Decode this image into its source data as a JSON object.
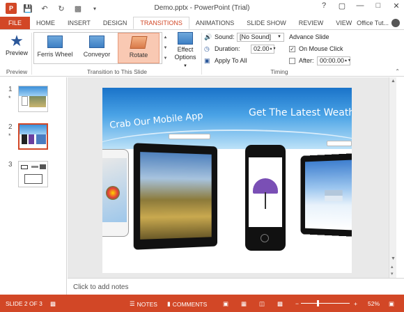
{
  "window": {
    "title": "Demo.pptx - PowerPoint (Trial)",
    "controls": [
      "?",
      "▢",
      "—",
      "□",
      "✕"
    ]
  },
  "ribbon_tabs": [
    "FILE",
    "HOME",
    "INSERT",
    "DESIGN",
    "TRANSITIONS",
    "ANIMATIONS",
    "SLIDE SHOW",
    "REVIEW",
    "VIEW"
  ],
  "active_tab": "TRANSITIONS",
  "account": {
    "name": "Office Tut..."
  },
  "preview": {
    "label": "Preview",
    "group_label": "Preview"
  },
  "transitions": {
    "items": [
      "Ferris Wheel",
      "Conveyor",
      "Rotate"
    ],
    "selected": "Rotate",
    "group_label": "Transition to This Slide",
    "effect_options_line1": "Effect",
    "effect_options_line2": "Options"
  },
  "timing": {
    "sound_label": "Sound:",
    "sound_value": "[No Sound]",
    "duration_label": "Duration:",
    "duration_value": "02.00",
    "apply_all_label": "Apply To All",
    "advance_label": "Advance Slide",
    "on_click_label": "On Mouse Click",
    "on_click_checked": true,
    "after_label": "After:",
    "after_checked": false,
    "after_value": "00:00.00",
    "group_label": "Timing"
  },
  "thumbnails": [
    {
      "number": "1",
      "marker": "*"
    },
    {
      "number": "2",
      "marker": "*",
      "selected": true
    },
    {
      "number": "3",
      "marker": ""
    }
  ],
  "slide": {
    "heading_left": "Crab Our Mobile App",
    "heading_right": "Get The Latest Weather Repo"
  },
  "notes_placeholder": "Click to add notes",
  "status": {
    "slide_indicator": "SLIDE 2 OF 3",
    "notes": "NOTES",
    "comments": "COMMENTS",
    "zoom": "52%"
  },
  "colors": {
    "accent": "#D24726",
    "selection_fill": "#F9C9B3"
  }
}
